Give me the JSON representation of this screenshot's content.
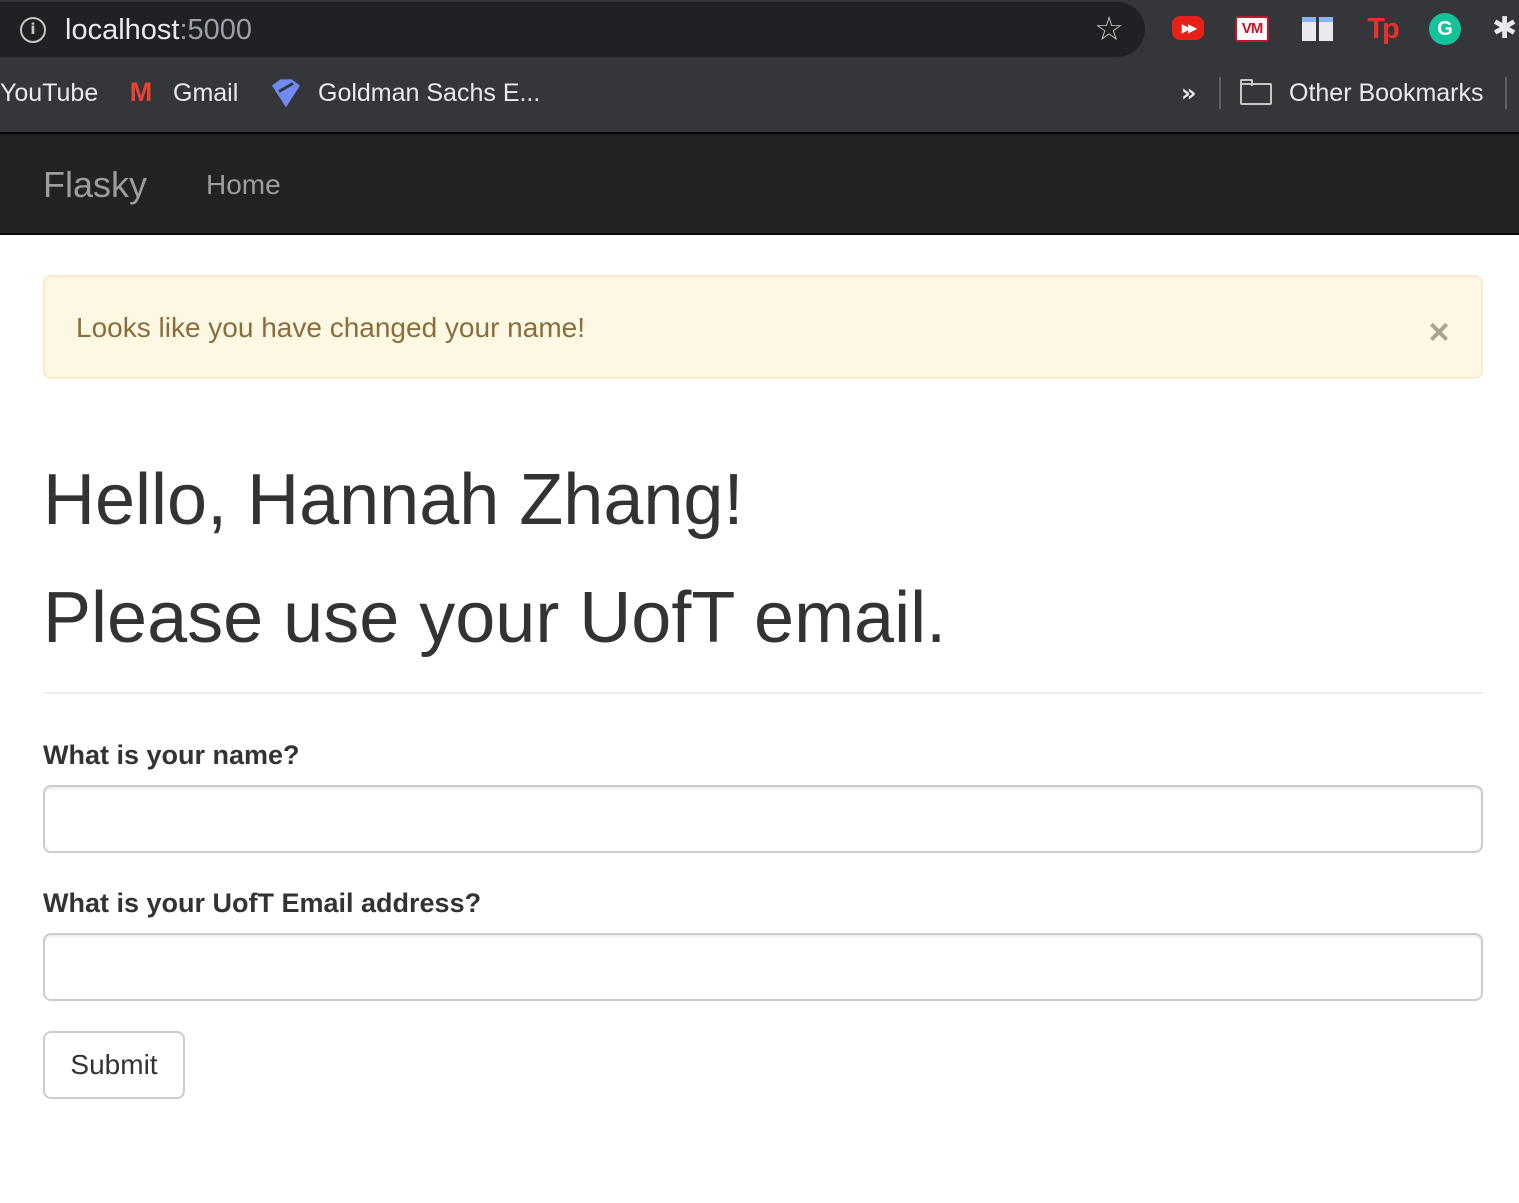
{
  "browser": {
    "url_host": "localhost",
    "url_port": ":5000",
    "extensions": [
      "youtube-icon",
      "vm-icon",
      "reader-icon",
      "tp-icon",
      "grammarly-icon",
      "puzzle-icon"
    ],
    "bookmarks": [
      {
        "label": "YouTube",
        "icon": ""
      },
      {
        "label": "Gmail",
        "icon": "gmail-icon"
      },
      {
        "label": "Goldman Sachs E...",
        "icon": "goldman-sachs-icon"
      }
    ],
    "more_glyph": "»",
    "other_bookmarks": "Other Bookmarks"
  },
  "navbar": {
    "brand": "Flasky",
    "links": [
      "Home"
    ],
    "background": "#222222",
    "link_color": "#9d9d9d"
  },
  "alert": {
    "message": "Looks like you have changed your name!",
    "close_glyph": "×",
    "background": "#fcf8e3",
    "text_color": "#8a6d3b"
  },
  "page": {
    "greeting": "Hello, Hannah Zhang!",
    "subheading": "Please use your UofT email."
  },
  "form": {
    "name_label": "What is your name?",
    "name_value": "",
    "email_label": "What is your UofT Email address?",
    "email_value": "",
    "submit_label": "Submit"
  }
}
